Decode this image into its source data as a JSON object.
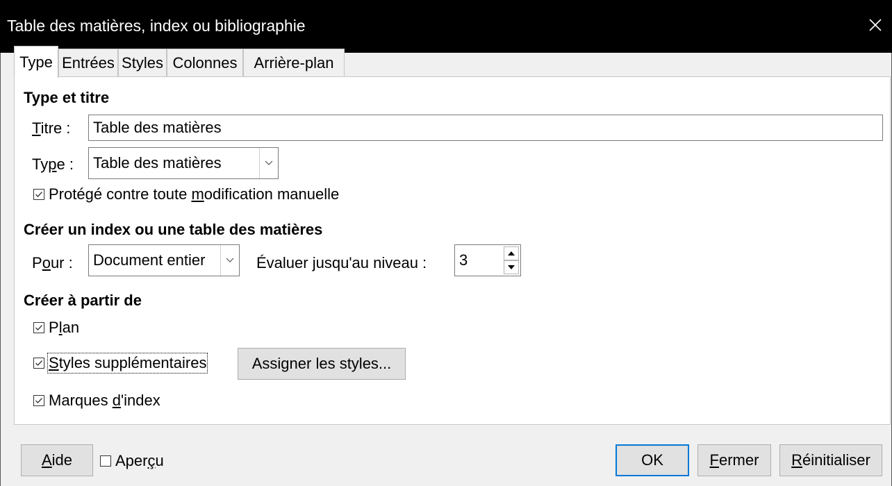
{
  "window": {
    "title": "Table des matières, index ou bibliographie",
    "close_icon": "close-icon"
  },
  "tabs": [
    {
      "label": "Type",
      "active": true
    },
    {
      "label": "Entrées",
      "active": false
    },
    {
      "label": "Styles",
      "active": false
    },
    {
      "label": "Colonnes",
      "active": false
    },
    {
      "label": "Arrière-plan",
      "active": false
    }
  ],
  "type_title": {
    "heading": "Type et titre",
    "title_label_ul": "T",
    "title_label_rest": "itre :",
    "title_value": "Table des matières",
    "type_label_pre": "Ty",
    "type_label_ul": "p",
    "type_label_post": "e :",
    "type_value": "Table des matières",
    "protect_pre": "Protégé contre toute ",
    "protect_ul": "m",
    "protect_post": "odification manuelle",
    "protect_checked": true
  },
  "create_index": {
    "heading": "Créer un index ou une table des matières",
    "for_label_pre": "P",
    "for_label_ul": "o",
    "for_label_post": "ur :",
    "for_value": "Document entier",
    "eval_label_pre": "Évaluer ",
    "eval_label_ul": "j",
    "eval_label_post": "usqu'au niveau :",
    "level_value": "3"
  },
  "create_from": {
    "heading": "Créer à partir de",
    "outline_pre": "P",
    "outline_ul": "l",
    "outline_post": "an",
    "outline_checked": true,
    "add_styles_ul": "S",
    "add_styles_rest": "tyles supplémentaires",
    "add_styles_checked": true,
    "assign_pre": "Assi",
    "assign_ul": "g",
    "assign_post": "ner les styles...",
    "index_marks_pre": "Marques ",
    "index_marks_ul": "d",
    "index_marks_post": "'index",
    "index_marks_checked": true
  },
  "footer": {
    "help_ul": "A",
    "help_rest": "ide",
    "preview_pre": "Aper",
    "preview_ul": "ç",
    "preview_post": "u",
    "preview_checked": false,
    "ok_label": "OK",
    "close_ul": "F",
    "close_rest": "ermer",
    "reset_ul": "R",
    "reset_rest": "éinitialiser"
  },
  "colors": {
    "titlebar_bg": "#000000",
    "default_button_border": "#0078d7"
  }
}
